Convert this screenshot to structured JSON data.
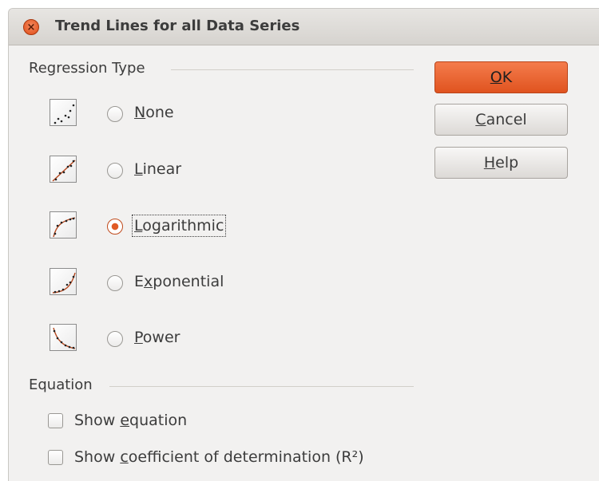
{
  "dialog": {
    "title": "Trend Lines for all Data Series",
    "close_icon": "close-icon"
  },
  "regression": {
    "heading": "Regression Type",
    "selected": "Logarithmic",
    "options": [
      {
        "pre": "",
        "mn": "N",
        "post": "one",
        "icon": "none-trend-icon",
        "checked": false
      },
      {
        "pre": "",
        "mn": "L",
        "post": "inear",
        "icon": "linear-trend-icon",
        "checked": false
      },
      {
        "pre": "",
        "mn": "L",
        "post": "ogarithmic",
        "icon": "logarithmic-trend-icon",
        "checked": true
      },
      {
        "pre": "E",
        "mn": "x",
        "post": "ponential",
        "icon": "exponential-trend-icon",
        "checked": false
      },
      {
        "pre": "",
        "mn": "P",
        "post": "ower",
        "icon": "power-trend-icon",
        "checked": false
      }
    ]
  },
  "equation": {
    "heading": "Equation",
    "show_equation": {
      "pre": "Show ",
      "mn": "e",
      "post": "quation",
      "checked": false
    },
    "show_r2": {
      "pre": "Show ",
      "mn": "c",
      "post": "oefficient of determination (R²)",
      "checked": false
    }
  },
  "buttons": {
    "ok": {
      "pre": "",
      "mn": "O",
      "post": "K"
    },
    "cancel": {
      "pre": "",
      "mn": "C",
      "post": "ancel"
    },
    "help": {
      "pre": "",
      "mn": "H",
      "post": "elp"
    }
  },
  "colors": {
    "accent": "#e0531f",
    "window_bg": "#f2f1f0",
    "trend_line": "#b5451b"
  }
}
